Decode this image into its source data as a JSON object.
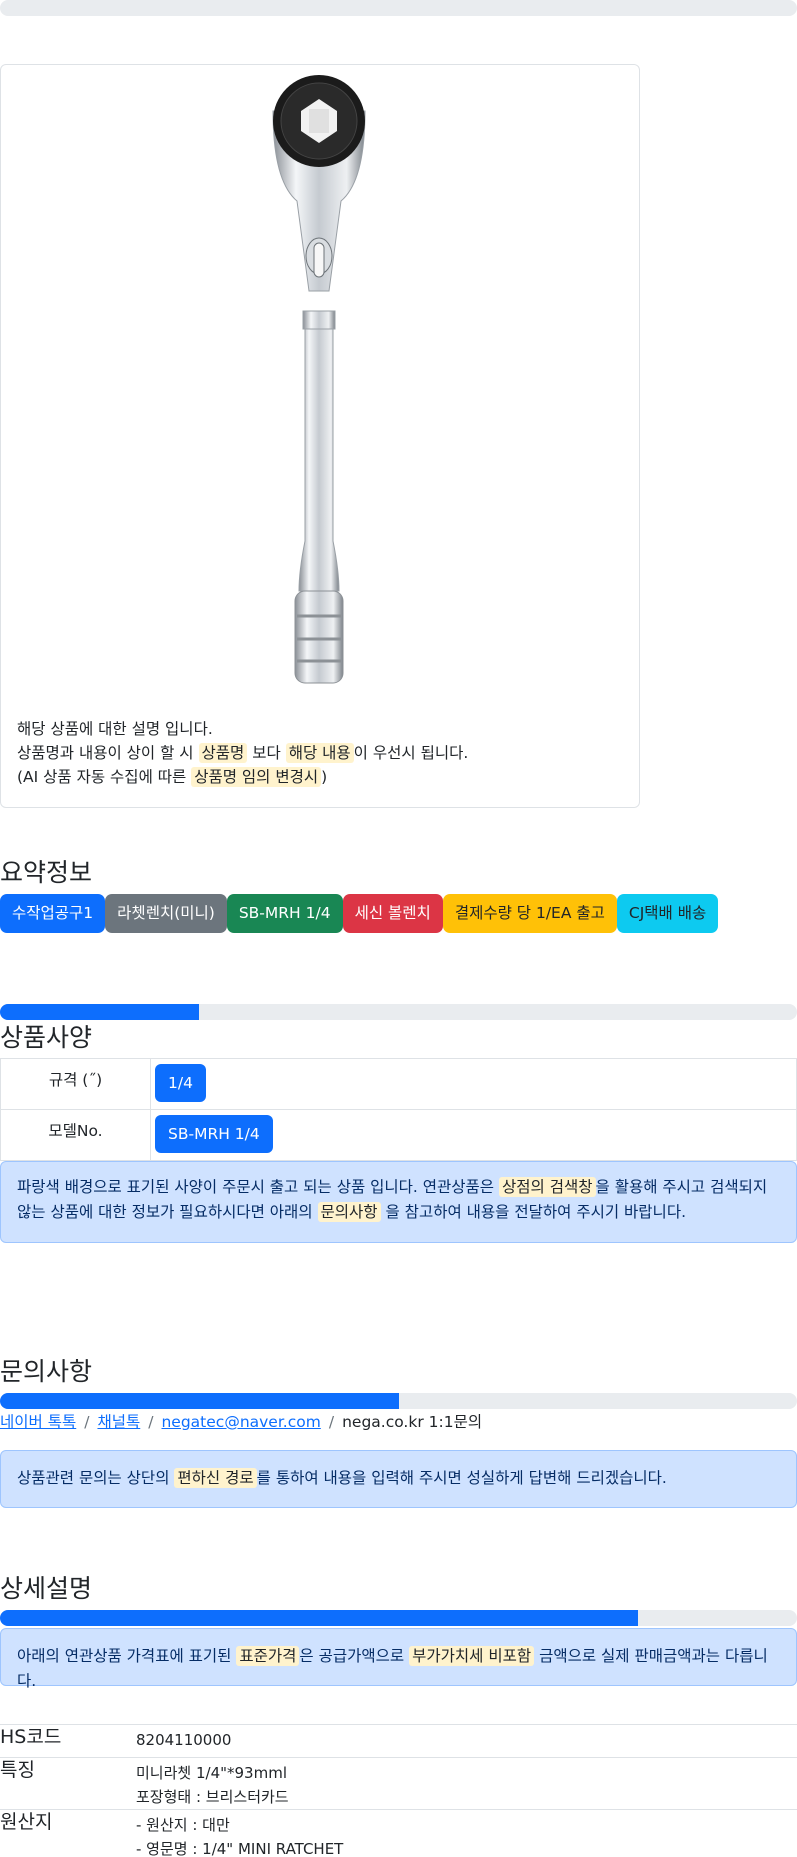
{
  "progress_top": {
    "percent": 0
  },
  "product_card": {
    "image_alt": "라쳇렌치 미니",
    "desc_line1": "해당 상품에 대한 설명 입니다.",
    "desc_line2_a": "상품명과 내용이 상이 할 시",
    "desc_line2_m1": "상품명",
    "desc_line2_b": "보다",
    "desc_line2_m2": "해당 내용",
    "desc_line2_c": "이 우선시 됩니다.",
    "desc_line3_a": "(AI 상품 자동 수집에 따른",
    "desc_line3_m": "상품명 임의 변경시",
    "desc_line3_b": ")"
  },
  "summary": {
    "title": "요약정보",
    "badges": [
      "수작업공구1",
      "라쳇렌치(미니)",
      "SB-MRH 1/4",
      "세신 볼렌치",
      "결제수량 당 1/EA 출고",
      "CJ택배 배송"
    ]
  },
  "spec": {
    "title": "상품사양",
    "progress_percent": 25,
    "rows": [
      {
        "key": "규격 (˝)",
        "value": "1/4"
      },
      {
        "key": "모델No.",
        "value": "SB-MRH 1/4"
      }
    ],
    "alert_a": "파랑색 배경으로 표기된 사양이 주문시 출고 되는 상품 입니다. 연관상품은",
    "alert_m1": "상점의 검색창",
    "alert_b": "을 활용해 주시고 검색되지 않는 상품에 대한 정보가 필요하시다면 아래의",
    "alert_m2": "문의사항",
    "alert_c": "을 참고하여 내용을 전달하여 주시기 바랍니다."
  },
  "inquiry": {
    "title": "문의사항",
    "progress_percent": 50,
    "links": [
      "네이버 톡톡",
      "채널톡",
      "negatec@naver.com"
    ],
    "plain": "nega.co.kr 1:1문의",
    "alert_a": "상품관련 문의는 상단의",
    "alert_m": "편하신 경로",
    "alert_b": "를 통하여 내용을 입력해 주시면 성실하게 답변해 드리겠습니다."
  },
  "detail": {
    "title": "상세설명",
    "progress_percent": 80,
    "alert_a": "아래의 연관상품 가격표에 표기된",
    "alert_m1": "표준가격",
    "alert_b": "은 공급가액으로",
    "alert_m2": "부가가치세 비포함",
    "alert_c": "금액으로 실제 판매금액과는 다릅니다.",
    "rows": [
      {
        "key": "HS코드",
        "lines": [
          "8204110000"
        ]
      },
      {
        "key": "특징",
        "lines": [
          "미니라쳇 1/4\"*93mml",
          "포장형태 : 브리스터카드"
        ]
      },
      {
        "key": "원산지",
        "lines": [
          "- 원산지 : 대만",
          "- 영문명 : 1/4\" MINI RATCHET"
        ]
      }
    ]
  },
  "colors": {
    "primary": "#0d6efd",
    "alert_bg": "#cfe2ff",
    "mark_bg": "#fff3cd"
  }
}
